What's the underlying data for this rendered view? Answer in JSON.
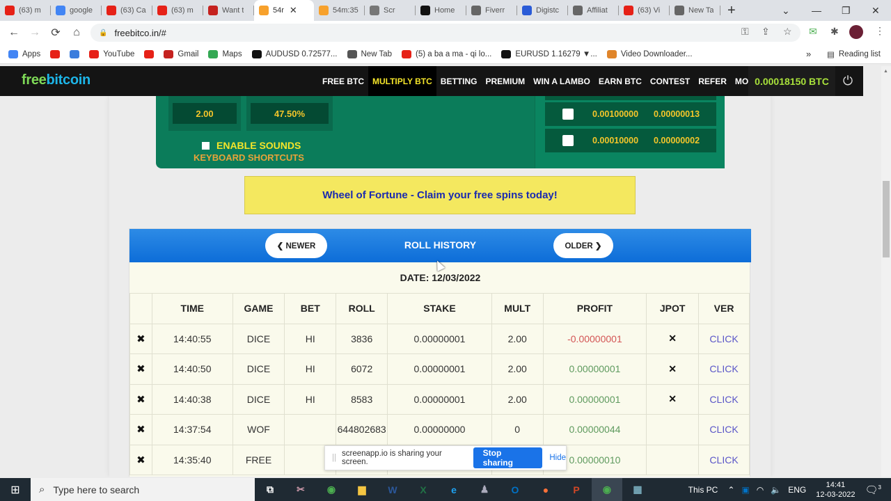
{
  "browser": {
    "tabs": [
      {
        "label": "(63) m",
        "icon": "youtube-icon",
        "color": "#e62117"
      },
      {
        "label": "google",
        "icon": "google-icon",
        "color": "#4285f4"
      },
      {
        "label": "(63) Ca",
        "icon": "youtube-icon",
        "color": "#e62117"
      },
      {
        "label": "(63) m",
        "icon": "youtube-icon",
        "color": "#e62117"
      },
      {
        "label": "Want t",
        "icon": "gmail-icon",
        "color": "#c5221f"
      },
      {
        "label": "54r",
        "icon": "bitcoin-icon",
        "color": "#f7a12c",
        "active": true
      },
      {
        "label": "54m:35",
        "icon": "bitcoin-icon",
        "color": "#f7a12c"
      },
      {
        "label": "Scr",
        "icon": "monitor-icon",
        "color": "#777"
      },
      {
        "label": "Home",
        "icon": "home-icon",
        "color": "#111"
      },
      {
        "label": "Fiverr",
        "icon": "globe-icon",
        "color": "#666"
      },
      {
        "label": "Digistc",
        "icon": "digistore-icon",
        "color": "#2a5bd7"
      },
      {
        "label": "Affiliat",
        "icon": "globe-icon",
        "color": "#666"
      },
      {
        "label": "(63) Vi",
        "icon": "youtube-icon",
        "color": "#e62117"
      },
      {
        "label": "New Ta",
        "icon": "chrome-icon",
        "color": "#666"
      }
    ],
    "url": "freebitco.in/#",
    "bookmarks": [
      {
        "label": "Apps",
        "icon": "apps-icon",
        "color": "#4285f4"
      },
      {
        "label": "",
        "icon": "youtube-icon",
        "color": "#e62117"
      },
      {
        "label": "",
        "icon": "star-bookmark-icon",
        "color": "#3b7ddd"
      },
      {
        "label": "YouTube",
        "icon": "youtube-icon",
        "color": "#e62117"
      },
      {
        "label": "",
        "icon": "youtube-icon",
        "color": "#e62117"
      },
      {
        "label": "Gmail",
        "icon": "gmail-icon",
        "color": "#c5221f"
      },
      {
        "label": "Maps",
        "icon": "maps-icon",
        "color": "#34a853"
      },
      {
        "label": "AUDUSD 0.72577...",
        "icon": "tradingview-icon",
        "color": "#111"
      },
      {
        "label": "New Tab",
        "icon": "globe-icon",
        "color": "#555"
      },
      {
        "label": "(5) a ba a ma - qi lo...",
        "icon": "youtube-icon",
        "color": "#e62117"
      },
      {
        "label": "EURUSD 1.16279 ▼...",
        "icon": "tradingview-icon",
        "color": "#111"
      },
      {
        "label": "Video Downloader...",
        "icon": "video-downloader-icon",
        "color": "#e0852a"
      }
    ],
    "reading_list": "Reading list"
  },
  "site": {
    "logo_free": "free",
    "logo_bitcoin": "bitcoin",
    "menu": [
      "FREE BTC",
      "MULTIPLY BTC",
      "BETTING",
      "PREMIUM",
      "WIN A LAMBO",
      "EARN BTC",
      "CONTEST",
      "REFER",
      "MORE ≫"
    ],
    "active_menu": "MULTIPLY BTC",
    "balance": "0.00018150 BTC"
  },
  "game": {
    "payout": "2.00",
    "win_chance": "47.50%",
    "enable_sounds": "ENABLE SOUNDS",
    "keyboard_shortcuts": "KEYBOARD SHORTCUTS",
    "jackpot_rows": [
      {
        "bet": "0.00100000",
        "cost": "0.00000013",
        "checked": false
      },
      {
        "bet": "0.00010000",
        "cost": "0.00000002",
        "checked": false
      }
    ]
  },
  "wof_banner": "Wheel of Fortune - Claim your free spins today!",
  "roll_history": {
    "title": "ROLL HISTORY",
    "newer": "❮ NEWER",
    "older": "OLDER ❯",
    "date": "DATE: 12/03/2022",
    "columns": [
      "",
      "TIME",
      "GAME",
      "BET",
      "ROLL",
      "STAKE",
      "MULT",
      "PROFIT",
      "JPOT",
      "VER"
    ],
    "rows": [
      {
        "time": "14:40:55",
        "game": "DICE",
        "bet": "HI",
        "roll": "3836",
        "stake": "0.00000001",
        "mult": "2.00",
        "profit": "-0.00000001",
        "profit_sign": "neg",
        "jpot": "✕",
        "ver": "CLICK"
      },
      {
        "time": "14:40:50",
        "game": "DICE",
        "bet": "HI",
        "roll": "6072",
        "stake": "0.00000001",
        "mult": "2.00",
        "profit": "0.00000001",
        "profit_sign": "pos",
        "jpot": "✕",
        "ver": "CLICK"
      },
      {
        "time": "14:40:38",
        "game": "DICE",
        "bet": "HI",
        "roll": "8583",
        "stake": "0.00000001",
        "mult": "2.00",
        "profit": "0.00000001",
        "profit_sign": "pos",
        "jpot": "✕",
        "ver": "CLICK"
      },
      {
        "time": "14:37:54",
        "game": "WOF",
        "bet": "",
        "roll": "644802683",
        "stake": "0.00000000",
        "mult": "0",
        "profit": "0.00000044",
        "profit_sign": "pos",
        "jpot": "",
        "ver": "CLICK"
      },
      {
        "time": "14:35:40",
        "game": "FREE",
        "bet": "",
        "roll": "",
        "stake": "",
        "mult": "",
        "profit": "0.00000010",
        "profit_sign": "pos",
        "jpot": "",
        "ver": "CLICK"
      }
    ]
  },
  "share_bar": {
    "message": "screenapp.io is sharing your screen.",
    "stop": "Stop sharing",
    "hide": "Hide"
  },
  "taskbar": {
    "search_placeholder": "Type here to search",
    "this_pc": "This PC",
    "language": "ENG",
    "time": "14:41",
    "date": "12-03-2022",
    "notifications": "3"
  }
}
